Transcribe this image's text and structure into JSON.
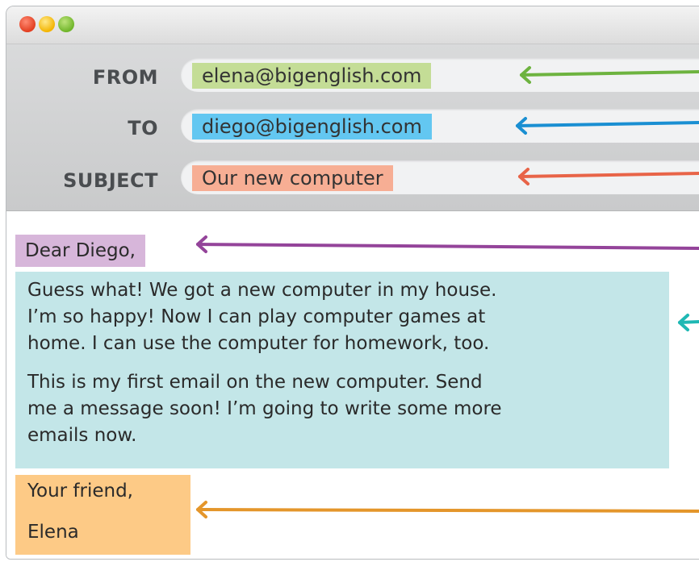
{
  "window": {
    "traffic_lights": [
      "close",
      "minimize",
      "zoom"
    ]
  },
  "header": {
    "from_label": "FROM",
    "from_value": "elena@bigenglish.com",
    "to_label": "TO",
    "to_value": "diego@bigenglish.com",
    "subject_label": "SUBJECT",
    "subject_value": "Our new computer"
  },
  "body": {
    "greeting": "Dear Diego,",
    "paragraph1": [
      "Guess what! We got a new computer in my house.",
      "I’m so happy! Now I can play computer games at",
      "home. I can use the computer for homework, too."
    ],
    "paragraph2": [
      "This is my first email on the new computer. Send",
      "me a message soon! I’m going to write some more",
      "emails now."
    ],
    "closing": "Your friend,",
    "signature": "Elena"
  },
  "colors": {
    "from_highlight": "#c4dd96",
    "to_highlight": "#63c7f1",
    "subject_highlight": "#f7ae94",
    "greeting_highlight": "#d7b6da",
    "body_highlight": "#c3e6e8",
    "closing_highlight": "#fdca86",
    "arrow_from": "#6db33f",
    "arrow_to": "#1a8fd2",
    "arrow_subject": "#e86448",
    "arrow_greeting": "#94449a",
    "arrow_body": "#1fb8b4",
    "arrow_closing": "#e4962b"
  }
}
